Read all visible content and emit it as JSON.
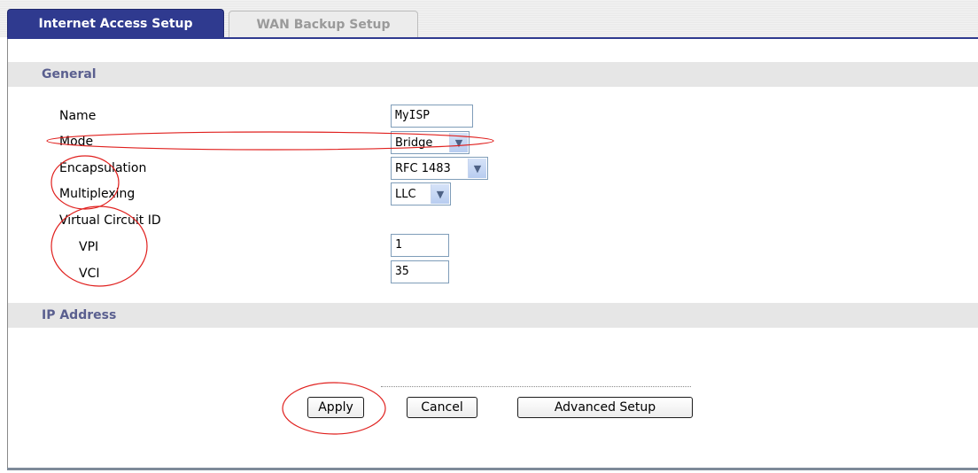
{
  "tabs": [
    {
      "label": "Internet Access Setup"
    },
    {
      "label": "WAN Backup Setup"
    }
  ],
  "sections": {
    "general": "General",
    "ip_address": "IP Address"
  },
  "form": {
    "name": {
      "label": "Name",
      "value": "MyISP"
    },
    "mode": {
      "label": "Mode",
      "value": "Bridge"
    },
    "encapsulation": {
      "label": "Encapsulation",
      "value": "RFC 1483"
    },
    "multiplexing": {
      "label": "Multiplexing",
      "value": "LLC"
    },
    "virtual_circuit": {
      "label": "Virtual Circuit ID"
    },
    "vpi": {
      "label": "VPI",
      "value": "1"
    },
    "vci": {
      "label": "VCI",
      "value": "35"
    }
  },
  "buttons": {
    "apply": "Apply",
    "cancel": "Cancel",
    "advanced": "Advanced Setup"
  },
  "colors": {
    "tab_active": "#2f3a8f",
    "section_text": "#5a5f8f",
    "annotation": "#e0201e"
  }
}
